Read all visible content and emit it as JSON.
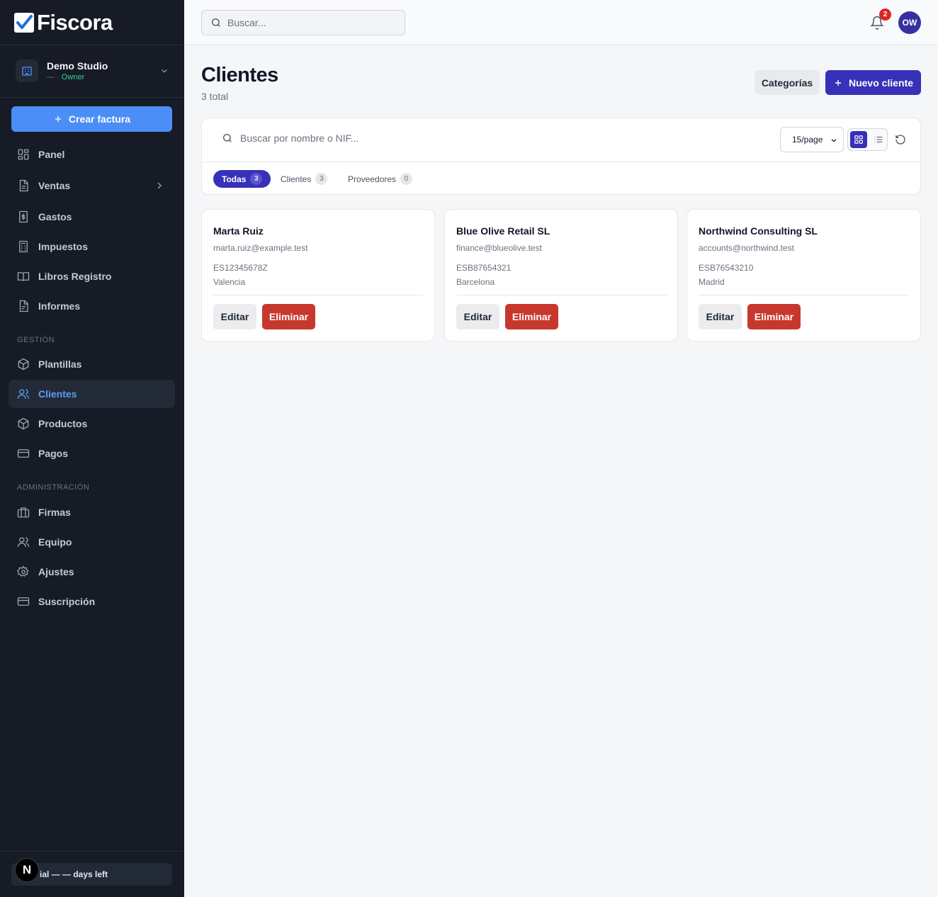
{
  "app": {
    "name": "Fiscora"
  },
  "org": {
    "name": "Demo Studio",
    "role_prefix": "— · ",
    "role": "Owner"
  },
  "sidebar": {
    "create_label": "Crear factura",
    "items": [
      {
        "label": "Panel",
        "icon": "grid-icon"
      },
      {
        "label": "Ventas",
        "icon": "document-icon"
      },
      {
        "label": "Gastos",
        "icon": "receipt-icon"
      },
      {
        "label": "Impuestos",
        "icon": "calculator-icon"
      },
      {
        "label": "Libros Registro",
        "icon": "book-icon"
      },
      {
        "label": "Informes",
        "icon": "report-icon"
      }
    ],
    "section_gestion": "GESTIÓN",
    "gestion_items": [
      {
        "label": "Plantillas",
        "icon": "package-icon"
      },
      {
        "label": "Clientes",
        "icon": "users-icon",
        "active": true
      },
      {
        "label": "Productos",
        "icon": "package-icon"
      },
      {
        "label": "Pagos",
        "icon": "card-icon"
      }
    ],
    "section_admin": "ADMINISTRACIÓN",
    "admin_items": [
      {
        "label": "Firmas",
        "icon": "briefcase-icon"
      },
      {
        "label": "Equipo",
        "icon": "users-icon"
      },
      {
        "label": "Ajustes",
        "icon": "gear-icon"
      },
      {
        "label": "Suscripción",
        "icon": "card-icon"
      }
    ],
    "trial_text": "ial — — days left",
    "badge_letter": "N"
  },
  "topbar": {
    "search_placeholder": "Buscar...",
    "notifications": "2",
    "avatar": "OW"
  },
  "page": {
    "title": "Clientes",
    "subtitle": "3 total",
    "categories_label": "Categorías",
    "new_label": "Nuevo cliente"
  },
  "filters": {
    "search_placeholder": "Buscar por nombre o NIF...",
    "per_page": "15/page",
    "tabs": [
      {
        "label": "Todas",
        "count": "3"
      },
      {
        "label": "Clientes",
        "count": "3"
      },
      {
        "label": "Proveedores",
        "count": "0"
      }
    ]
  },
  "clients": [
    {
      "name": "Marta Ruiz",
      "email": "marta.ruiz@example.test",
      "nif": "ES12345678Z",
      "city": "Valencia"
    },
    {
      "name": "Blue Olive Retail SL",
      "email": "finance@blueolive.test",
      "nif": "ESB87654321",
      "city": "Barcelona"
    },
    {
      "name": "Northwind Consulting SL",
      "email": "accounts@northwind.test",
      "nif": "ESB76543210",
      "city": "Madrid"
    }
  ],
  "card_actions": {
    "edit": "Editar",
    "delete": "Eliminar"
  },
  "colors": {
    "sidebar_bg": "#161b26",
    "accent": "#3730b8",
    "create_btn": "#4b8ef7",
    "danger": "#c8372d",
    "active_nav": "#5b9bf8"
  }
}
